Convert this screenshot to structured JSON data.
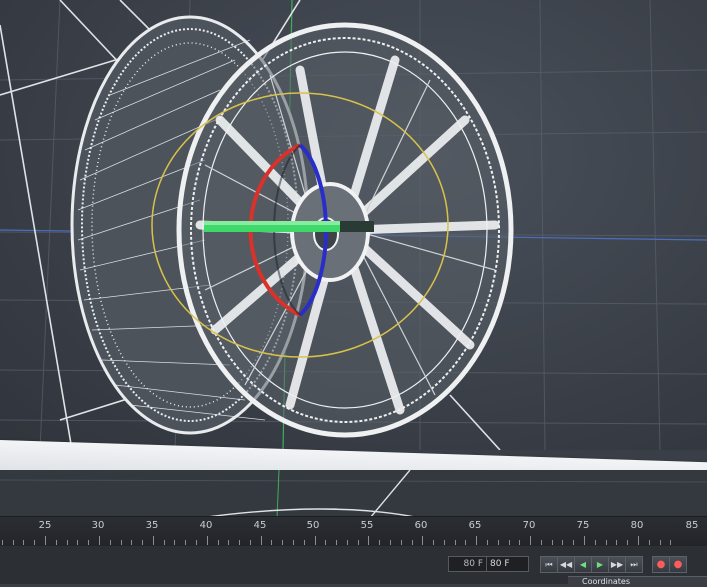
{
  "viewport": {
    "object": "wheel-rim-wireframe",
    "axis_colors": {
      "x": "#d8322a",
      "y": "#3fd86a",
      "z": "#2a2ec8"
    },
    "grid_color": "#5b626c",
    "wire_color": "#e9ecee"
  },
  "timeline": {
    "ticks": [
      "25",
      "30",
      "35",
      "40",
      "45",
      "50",
      "55",
      "60",
      "65",
      "70",
      "75",
      "80",
      "85"
    ]
  },
  "playback": {
    "start_frame": "80 F",
    "current_frame": "80 F",
    "buttons": [
      {
        "id": "go-to-start",
        "icon": "skip-back-icon",
        "label": "⏮"
      },
      {
        "id": "prev-key",
        "icon": "prev-key-icon",
        "label": "◀◀"
      },
      {
        "id": "play-back",
        "icon": "play-back-icon",
        "label": "◀"
      },
      {
        "id": "play-forward",
        "icon": "play-icon",
        "label": "▶"
      },
      {
        "id": "next-key",
        "icon": "next-key-icon",
        "label": "▶▶"
      },
      {
        "id": "go-to-end",
        "icon": "skip-forward-icon",
        "label": "⏭"
      },
      {
        "id": "record",
        "icon": "record-icon",
        "label": "●"
      },
      {
        "id": "auto-key",
        "icon": "auto-key-icon",
        "label": "●"
      }
    ]
  },
  "panel": {
    "coordinates_tab": "Coordinates"
  }
}
